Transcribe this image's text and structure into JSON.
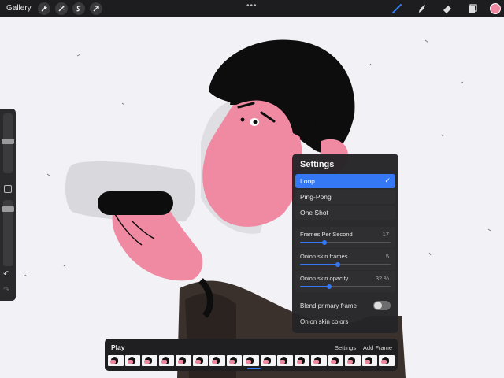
{
  "topbar": {
    "gallery_label": "Gallery",
    "left_icons": [
      "wrench-icon",
      "magic-wand-icon",
      "selection-s-icon",
      "transform-arrow-icon"
    ],
    "right_tools": [
      "brush-icon",
      "smudge-icon",
      "eraser-icon",
      "layers-icon"
    ],
    "active_tool": "brush-icon",
    "current_color": "#f08aa3"
  },
  "settings": {
    "title": "Settings",
    "options": [
      {
        "label": "Loop",
        "selected": true
      },
      {
        "label": "Ping-Pong",
        "selected": false
      },
      {
        "label": "One Shot",
        "selected": false
      }
    ],
    "sliders": [
      {
        "label": "Frames Per Second",
        "value_text": "17",
        "level": 0.27
      },
      {
        "label": "Onion skin frames",
        "value_text": "5",
        "level": 0.42
      },
      {
        "label": "Onion skin opacity",
        "value_text": "32 %",
        "level": 0.32
      }
    ],
    "blend_label": "Blend primary frame",
    "blend_on": false,
    "skin_colors_label": "Onion skin colors"
  },
  "timeline": {
    "play_label": "Play",
    "settings_label": "Settings",
    "add_frame_label": "Add Frame",
    "frame_count": 17,
    "current_frame_index": 8
  },
  "colors": {
    "accent": "#3478f6",
    "skin": "#f08aa3",
    "hair": "#0d0d0d",
    "panel": "#242426"
  }
}
